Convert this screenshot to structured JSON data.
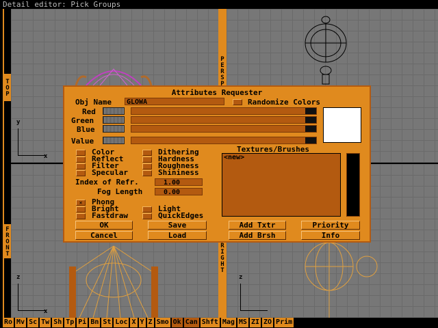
{
  "window": {
    "title": "Detail editor: Pick Groups"
  },
  "viewports": {
    "top": {
      "label": "TOP",
      "axis_x": "x",
      "axis_y": "y"
    },
    "persp": {
      "label": "PERSP"
    },
    "front": {
      "label": "FRONT",
      "axis_x": "x",
      "axis_y": "z"
    },
    "right": {
      "label": "RIGHT",
      "axis_y": "z"
    }
  },
  "toolbar": [
    {
      "label": "Ro"
    },
    {
      "label": "Mv"
    },
    {
      "label": "Sc"
    },
    {
      "label": "Tw"
    },
    {
      "label": "Sh"
    },
    {
      "label": "Tp"
    },
    {
      "label": "Pi"
    },
    {
      "label": "Bn"
    },
    {
      "label": "St"
    },
    {
      "label": "Loc"
    },
    {
      "label": "X"
    },
    {
      "label": "Y"
    },
    {
      "label": "Z"
    },
    {
      "label": "Smo"
    },
    {
      "label": "Ok"
    },
    {
      "label": "Can"
    },
    {
      "label": "Shft"
    },
    {
      "label": "Mag"
    },
    {
      "label": "MS"
    },
    {
      "label": "ZI"
    },
    {
      "label": "ZO"
    },
    {
      "label": "Prim"
    }
  ],
  "dialog": {
    "title": "Attributes Requester",
    "obj_name_label": "Obj Name",
    "obj_name_value": "GLOWA",
    "randomize_label": "Randomize Colors",
    "red_label": "Red",
    "green_label": "Green",
    "blue_label": "Blue",
    "value_label": "Value",
    "textures_label": "Textures/Brushes",
    "textures_list": [
      "<new>"
    ],
    "options_left": [
      "Color",
      "Reflect",
      "Filter",
      "Specular"
    ],
    "options_right": [
      "Dithering",
      "Hardness",
      "Roughness",
      "Shininess"
    ],
    "index_label": "Index of Refr.",
    "index_value": "1.00",
    "fog_label": "Fog Length",
    "fog_value": "0.00",
    "phong_label": "Phong",
    "phong_mark": "✕",
    "bright_label": "Bright",
    "fastdraw_label": "Fastdraw",
    "light_label": "Light",
    "quickedges_label": "QuickEdges",
    "ok_label": "OK",
    "save_label": "Save",
    "add_txtr_label": "Add Txtr",
    "priority_label": "Priority",
    "cancel_label": "Cancel",
    "load_label": "Load",
    "add_brsh_label": "Add Brsh",
    "info_label": "Info",
    "swatch_color": "#ffffff"
  }
}
